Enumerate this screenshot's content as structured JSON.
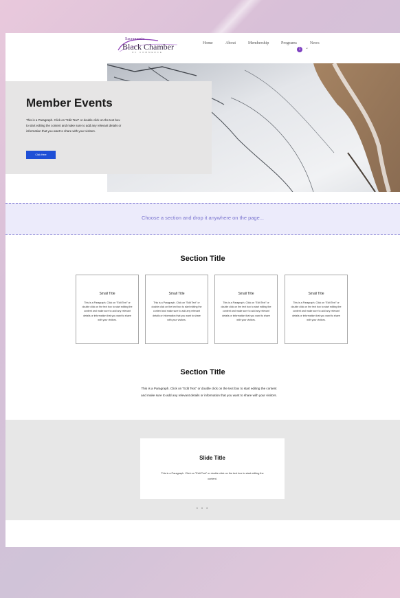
{
  "header": {
    "logo": {
      "small": "Sacramento",
      "main": "Black Chamber",
      "sub": "OF COMMERCE"
    },
    "nav": [
      "Home",
      "About",
      "Membership",
      "Programs",
      "News"
    ],
    "badge": "1",
    "chevron": "chevron-down-icon"
  },
  "hero": {
    "title": "Member Events",
    "paragraph": "This is a Paragraph. Click on \"Edit Text\" or double click on the text box to start editing the content and make sure to add any relevant details or information that you want to share with your visitors.",
    "button": "Click Here"
  },
  "dropzone": {
    "text": "Choose a section and drop it anywhere on the page..."
  },
  "section1": {
    "title": "Section Title",
    "cards": [
      {
        "title": "Small Title",
        "text": "This is a Paragraph. Click on \"Edit Text\" or double click on the text box to start editing the content and make sure to add any relevant details or information that you want to share with your visitors."
      },
      {
        "title": "Small Title",
        "text": "This is a Paragraph. Click on \"Edit Text\" or double click on the text box to start editing the content and make sure to add any relevant details or information that you want to share with your visitors."
      },
      {
        "title": "Small Title",
        "text": "This is a Paragraph. Click on \"Edit Text\" or double click on the text box to start editing the content and make sure to add any relevant details or information that you want to share with your visitors."
      },
      {
        "title": "Small Title",
        "text": "This is a Paragraph. Click on \"Edit Text\" or double click on the text box to start editing the content and make sure to add any relevant details or information that you want to share with your visitors."
      }
    ]
  },
  "section2": {
    "title": "Section Title",
    "paragraph": "This is a Paragraph. Click on \"Edit Text\" or double click on the text box to start editing the content and make sure to add any relevant details or information that you want to share with your visitors."
  },
  "slideshow": {
    "title": "Slide Title",
    "text": "This is a Paragraph. Click on \"Edit Text\" or double click on the text box to start editing the content.",
    "dots": "• • •"
  }
}
